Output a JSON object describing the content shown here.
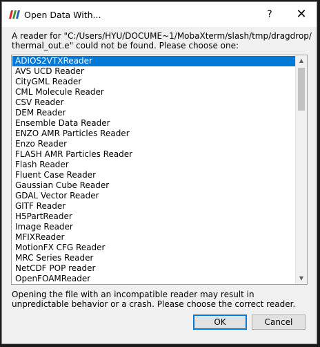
{
  "window": {
    "title": "Open Data With...",
    "help_label": "?",
    "close_label": "✕"
  },
  "message": "A reader for \"C:/Users/HYU/DOCUME~1/MobaXterm/slash/tmp/dragdrop/\nthermal_out.e\" could not be found. Please choose one:",
  "readers": {
    "selected_index": 0,
    "items": [
      "ADIOS2VTXReader",
      "AVS UCD Reader",
      "CityGML Reader",
      "CML Molecule Reader",
      "CSV Reader",
      "DEM Reader",
      "Ensemble Data Reader",
      "ENZO AMR Particles Reader",
      "Enzo Reader",
      "FLASH AMR Particles Reader",
      "Flash Reader",
      "Fluent Case Reader",
      "Gaussian Cube Reader",
      "GDAL Vector Reader",
      "GlTF Reader",
      "H5PartReader",
      "Image Reader",
      "MFIXReader",
      "MotionFX CFG Reader",
      "MRC Series Reader",
      "NetCDF POP reader",
      "OpenFOAMReader"
    ]
  },
  "warning": "Opening the file with an incompatible reader may result in unpredictable behavior or a crash.  Please choose the correct reader.",
  "buttons": {
    "ok": "OK",
    "cancel": "Cancel"
  }
}
